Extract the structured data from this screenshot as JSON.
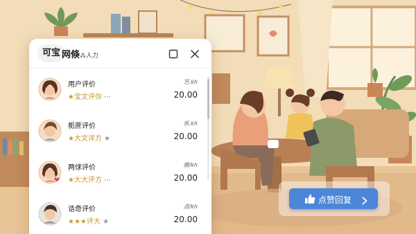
{
  "header": {
    "badge": "可宝",
    "title": "网倏",
    "subtitle": "⁂人力",
    "maximize_icon": "square-icon",
    "close_icon": "close-icon"
  },
  "list": [
    {
      "title": "用户评价",
      "stars_text": "★宝文评你",
      "more": "⋯",
      "gray_star": "",
      "unit": "万.kh",
      "price": "20.00",
      "avatar": "girl-avatar"
    },
    {
      "title": "栀蔗评价",
      "stars_text": "★大文诨方",
      "more": "",
      "gray_star": "★",
      "unit": "乐.kh",
      "price": "20.00",
      "avatar": "boy-avatar"
    },
    {
      "title": "两俅评价",
      "stars_text": "★大大评方",
      "more": "⋯",
      "gray_star": "",
      "unit": "原/kh",
      "price": "20.00",
      "avatar": "girl-heart-avatar"
    },
    {
      "title": "诰奇评价",
      "stars_text": "★★★评大",
      "more": "",
      "gray_star": "★",
      "unit": "点/kh",
      "price": "20.00",
      "avatar": "man-avatar"
    }
  ],
  "action": {
    "label": "点赞回复",
    "icon": "thumbs-up-icon",
    "arrow": "chevron-right-icon"
  },
  "colors": {
    "accent": "#4c86d9",
    "star": "#c79a2e",
    "wall": "#f3dcb8"
  }
}
